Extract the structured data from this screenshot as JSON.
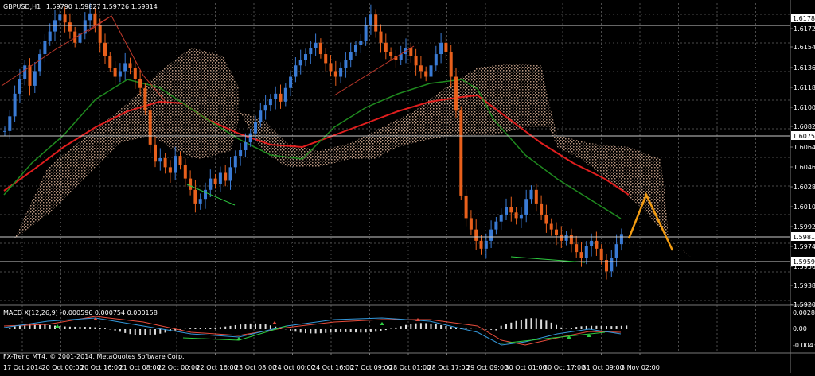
{
  "chart_header": {
    "symbol_label": "GBPUSD,H1",
    "ohlc": "1.59790 1.59827 1.59726 1.59814"
  },
  "macd_label": "MACD X(12,26,9) -0.000596 0.000754 0.000158",
  "copyright": "FX-Trend MT4, © 2001-2014, MetaQuotes Software Corp.",
  "price_axis": {
    "ticks": [
      "1.61787",
      "1.61725",
      "1.61545",
      "1.61365",
      "1.61185",
      "1.61005",
      "1.60825",
      "1.60750",
      "1.60645",
      "1.60465",
      "1.60285",
      "1.60105",
      "1.59925",
      "1.59814",
      "1.59745",
      "1.59590",
      "1.59565",
      "1.59385",
      "1.59205"
    ],
    "highlighted": [
      "1.61787",
      "1.60750",
      "1.59814",
      "1.59590"
    ]
  },
  "macd_axis": {
    "ticks": [
      "0.002854",
      "0.00",
      "-0.004360"
    ]
  },
  "time_axis": {
    "labels": [
      "17 Oct 2014",
      "20 Oct 00:00",
      "20 Oct 16:00",
      "21 Oct 08:00",
      "22 Oct 00:00",
      "22 Oct 16:00",
      "23 Oct 08:00",
      "24 Oct 00:00",
      "24 Oct 16:00",
      "27 Oct 09:00",
      "28 Oct 01:00",
      "28 Oct 17:00",
      "29 Oct 09:00",
      "30 Oct 01:00",
      "30 Oct 17:00",
      "31 Oct 09:00",
      "3 Nov 02:00"
    ]
  },
  "colors": {
    "background": "#000000",
    "grid": "#4a4a4a",
    "bull_candle": "#3a7bd5",
    "bear_candle": "#e8601c",
    "ma_red": "#e01e1e",
    "ma_green": "#1f8a1f",
    "cloud": "#c8a28a",
    "projection": "#f39c12",
    "text": "#ffffff"
  },
  "chart_data": {
    "type": "candlestick",
    "symbol": "GBPUSD",
    "timeframe": "H1",
    "ylim": [
      1.5918,
      1.6185
    ],
    "close_series": [
      1.6072,
      1.6085,
      1.6105,
      1.6118,
      1.613,
      1.6112,
      1.6125,
      1.614,
      1.6152,
      1.616,
      1.617,
      1.6175,
      1.6168,
      1.616,
      1.615,
      1.6158,
      1.617,
      1.6176,
      1.6165,
      1.615,
      1.6138,
      1.6128,
      1.612,
      1.6125,
      1.6132,
      1.6128,
      1.6118,
      1.611,
      1.609,
      1.606,
      1.6045,
      1.6048,
      1.604,
      1.6035,
      1.605,
      1.6042,
      1.603,
      1.602,
      1.6008,
      1.6012,
      1.602,
      1.603,
      1.6025,
      1.6035,
      1.6028,
      1.604,
      1.605,
      1.6055,
      1.6062,
      1.607,
      1.608,
      1.609,
      1.6095,
      1.61,
      1.6105,
      1.6098,
      1.611,
      1.612,
      1.613,
      1.6135,
      1.614,
      1.6145,
      1.615,
      1.614,
      1.6132,
      1.6125,
      1.612,
      1.6128,
      1.6135,
      1.6142,
      1.6148,
      1.6152,
      1.6165,
      1.6175,
      1.616,
      1.615,
      1.6142,
      1.6138,
      1.6135,
      1.614,
      1.6145,
      1.6138,
      1.613,
      1.6125,
      1.612,
      1.613,
      1.614,
      1.615,
      1.6142,
      1.612,
      1.609,
      1.6015,
      1.5995,
      1.5985,
      1.5975,
      1.5968,
      1.5975,
      1.5985,
      1.5992,
      1.5998,
      1.6005,
      1.6,
      1.5995,
      1.5998,
      1.6012,
      1.602,
      1.6008,
      1.5998,
      1.599,
      1.5985,
      1.598,
      1.5975,
      1.598,
      1.5972,
      1.5965,
      1.596,
      1.597,
      1.5975,
      1.5968,
      1.5958,
      1.5948,
      1.596,
      1.5972,
      1.5981
    ]
  }
}
